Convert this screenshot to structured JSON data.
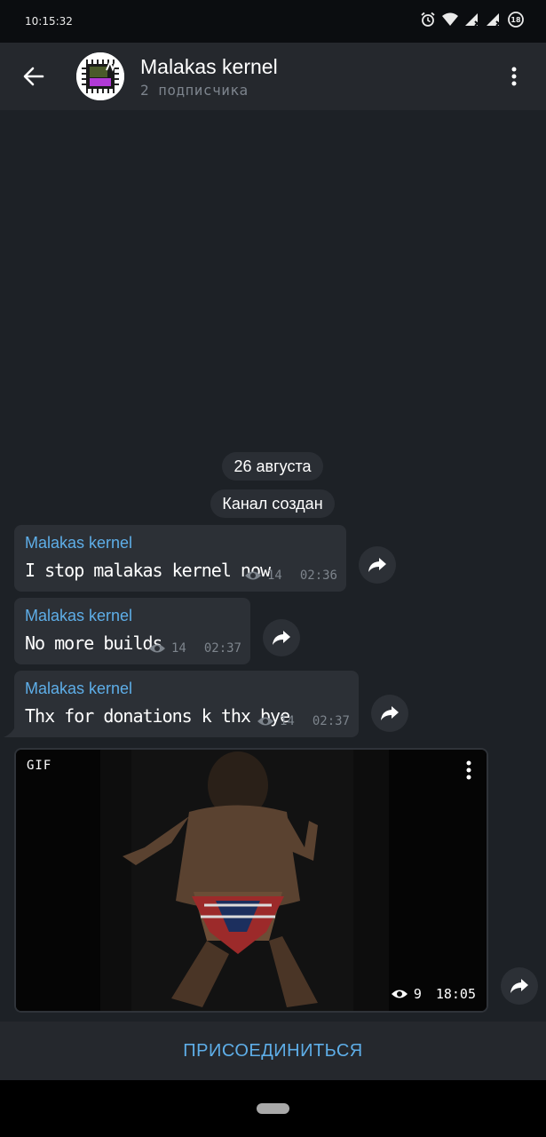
{
  "status_bar": {
    "time": "10:15:32",
    "battery_level": "18"
  },
  "header": {
    "title": "Malakas kernel",
    "subtitle": "2 подписчика"
  },
  "chat": {
    "date_chip": "26 августа",
    "service_message": "Канал создан",
    "messages": [
      {
        "sender": "Malakas kernel",
        "text": "I stop malakas kernel now",
        "views": "14",
        "time": "02:36"
      },
      {
        "sender": "Malakas kernel",
        "text": "No more builds",
        "views": "14",
        "time": "02:37"
      },
      {
        "sender": "Malakas kernel",
        "text": "Thx for donations k thx bye",
        "views": "14",
        "time": "02:37"
      }
    ],
    "gif_message": {
      "badge": "GIF",
      "views": "9",
      "time": "18:05"
    }
  },
  "footer": {
    "join_label": "ПРИСОЕДИНИТЬСЯ"
  },
  "colors": {
    "accent": "#5eaee8",
    "background": "#1d2126",
    "bubble": "#2c3036",
    "header": "#25282d"
  }
}
